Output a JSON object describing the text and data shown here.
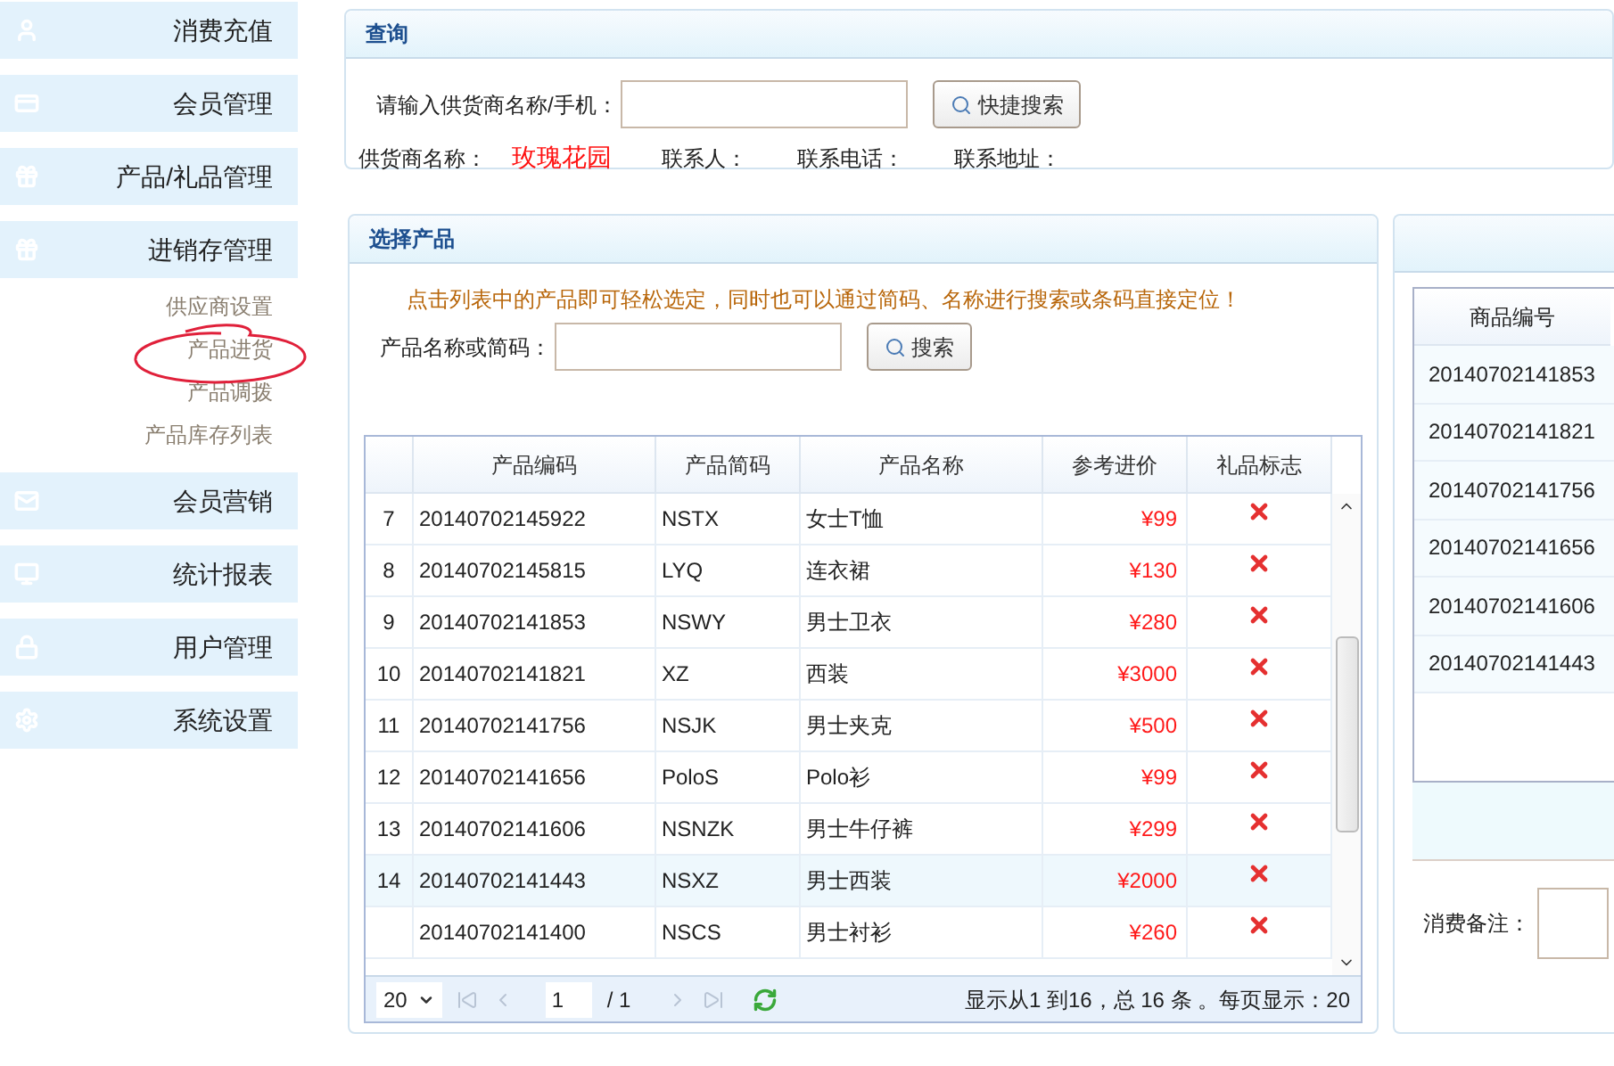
{
  "sidebar": {
    "items": [
      {
        "label": "消费充值"
      },
      {
        "label": "会员管理"
      },
      {
        "label": "产品/礼品管理"
      },
      {
        "label": "进销存管理",
        "children": [
          {
            "label": "供应商设置"
          },
          {
            "label": "产品进货"
          },
          {
            "label": "产品调拨"
          },
          {
            "label": "产品库存列表"
          }
        ]
      },
      {
        "label": "会员营销"
      },
      {
        "label": "统计报表"
      },
      {
        "label": "用户管理"
      },
      {
        "label": "系统设置"
      }
    ]
  },
  "query_panel": {
    "title": "查询",
    "search_label": "请输入供货商名称/手机：",
    "search_button": "快捷搜索",
    "info": [
      {
        "label": "供货商名称：",
        "value": "玫瑰花园"
      },
      {
        "label": "联系人："
      },
      {
        "label": "联系电话："
      },
      {
        "label": "联系地址："
      }
    ]
  },
  "product_panel": {
    "title": "选择产品",
    "hint": "点击列表中的产品即可轻松选定，同时也可以通过简码、名称进行搜索或条码直接定位！",
    "search_label": "产品名称或简码：",
    "search_button": "搜索",
    "table": {
      "columns": [
        "产品编码",
        "产品简码",
        "产品名称",
        "参考进价",
        "礼品标志"
      ],
      "rows": [
        {
          "no": "7",
          "code": "20140702145922",
          "short": "NSTX",
          "name": "女士T恤",
          "price": "¥99",
          "gift": false,
          "selected": false
        },
        {
          "no": "8",
          "code": "20140702145815",
          "short": "LYQ",
          "name": "连衣裙",
          "price": "¥130",
          "gift": false,
          "selected": false
        },
        {
          "no": "9",
          "code": "20140702141853",
          "short": "NSWY",
          "name": "男士卫衣",
          "price": "¥280",
          "gift": false,
          "selected": false
        },
        {
          "no": "10",
          "code": "20140702141821",
          "short": "XZ",
          "name": "西装",
          "price": "¥3000",
          "gift": false,
          "selected": false
        },
        {
          "no": "11",
          "code": "20140702141756",
          "short": "NSJK",
          "name": "男士夹克",
          "price": "¥500",
          "gift": false,
          "selected": false
        },
        {
          "no": "12",
          "code": "20140702141656",
          "short": "PoloS",
          "name": "Polo衫",
          "price": "¥99",
          "gift": false,
          "selected": false
        },
        {
          "no": "13",
          "code": "20140702141606",
          "short": "NSNZK",
          "name": "男士牛仔裤",
          "price": "¥299",
          "gift": false,
          "selected": false
        },
        {
          "no": "14",
          "code": "20140702141443",
          "short": "NSXZ",
          "name": "男士西装",
          "price": "¥2000",
          "gift": false,
          "selected": true
        },
        {
          "code": "20140702141400",
          "short": "NSCS",
          "name": "男士衬衫",
          "price": "¥260",
          "gift": false,
          "selected": false
        }
      ]
    },
    "pager": {
      "page_size": "20",
      "page": "1",
      "of_pages": "/ 1",
      "summary": "显示从1 到16，总 16 条 。每页显示：20"
    }
  },
  "order_panel": {
    "columns": [
      "商品编号"
    ],
    "rows": [
      "20140702141853",
      "20140702141821",
      "20140702141756",
      "20140702141656",
      "20140702141606",
      "20140702141443"
    ],
    "note_label": "消费备注："
  }
}
